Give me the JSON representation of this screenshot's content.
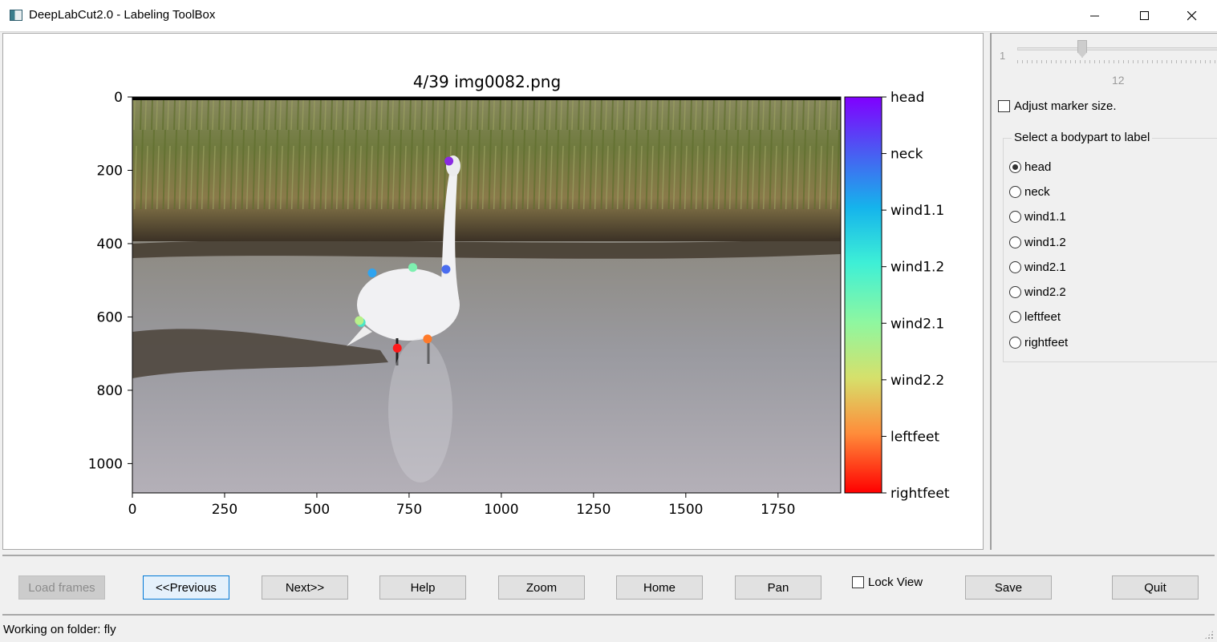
{
  "window": {
    "title": "DeepLabCut2.0 - Labeling ToolBox",
    "app_icon": "app-window-icon",
    "controls": [
      "minimize-icon",
      "maximize-icon",
      "close-icon"
    ]
  },
  "plot": {
    "title": "4/39 img0082.png",
    "x_ticks": [
      "0",
      "250",
      "500",
      "750",
      "1000",
      "1250",
      "1500",
      "1750"
    ],
    "y_ticks": [
      "0",
      "200",
      "400",
      "600",
      "800",
      "1000"
    ],
    "xlim": [
      0,
      1920
    ],
    "ylim": [
      1080,
      0
    ],
    "image_description_colors": {
      "sky": "#9aa7b3",
      "grass": "#6a7a3a",
      "water": "#8a8578"
    },
    "colorbar": {
      "colormap": "rainbow",
      "labels": [
        "head",
        "neck",
        "wind1.1",
        "wind1.2",
        "wind2.1",
        "wind2.2",
        "leftfeet",
        "rightfeet"
      ]
    },
    "markers": [
      {
        "bodypart": "head",
        "x": 858,
        "y": 175,
        "color": "#8b2be2"
      },
      {
        "bodypart": "neck",
        "x": 850,
        "y": 470,
        "color": "#4a6df0"
      },
      {
        "bodypart": "wind1.1",
        "x": 650,
        "y": 480,
        "color": "#2fa4f0"
      },
      {
        "bodypart": "wind1.2",
        "x": 760,
        "y": 465,
        "color": "#7ef0b0"
      },
      {
        "bodypart": "wind2.1",
        "x": 620,
        "y": 615,
        "color": "#4ae6c8"
      },
      {
        "bodypart": "wind2.2",
        "x": 615,
        "y": 610,
        "color": "#b8f08a"
      },
      {
        "bodypart": "leftfeet",
        "x": 800,
        "y": 660,
        "color": "#ff7a2a"
      },
      {
        "bodypart": "rightfeet",
        "x": 718,
        "y": 685,
        "color": "#ff1a1a"
      }
    ]
  },
  "sidebar": {
    "slider": {
      "min_label": "1",
      "value": 12,
      "value_label": "12"
    },
    "adjust_marker_label": "Adjust marker size.",
    "adjust_marker_checked": false,
    "bodypart_group_title": "Select a bodypart to label",
    "bodyparts": [
      "head",
      "neck",
      "wind1.1",
      "wind1.2",
      "wind2.1",
      "wind2.2",
      "leftfeet",
      "rightfeet"
    ],
    "selected_bodypart": "head"
  },
  "toolbar": {
    "load_frames": "Load frames",
    "previous": "<<Previous",
    "next": "Next>>",
    "help": "Help",
    "zoom": "Zoom",
    "home": "Home",
    "pan": "Pan",
    "lock_view": "Lock View",
    "save": "Save",
    "quit": "Quit"
  },
  "status": {
    "text": "Working on folder: fly"
  }
}
